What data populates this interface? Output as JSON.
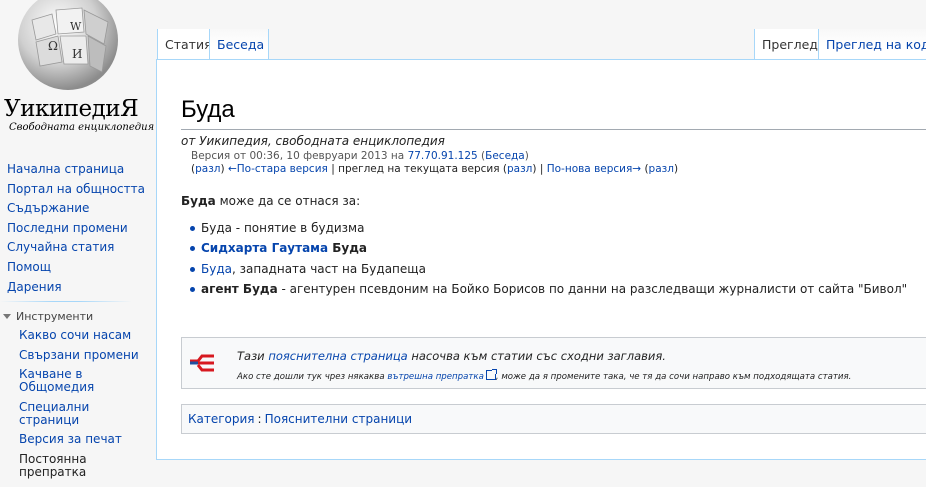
{
  "logo": {
    "wordmark": "УикипедиЯ",
    "tagline": "Свободната енциклопедия",
    "globe_glyphs": [
      "Ω",
      "W",
      "И"
    ]
  },
  "navigation": {
    "items": [
      {
        "label": "Начална страница"
      },
      {
        "label": "Портал на общността"
      },
      {
        "label": "Съдържание"
      },
      {
        "label": "Последни промени"
      },
      {
        "label": "Случайна статия"
      },
      {
        "label": "Помощ"
      },
      {
        "label": "Дарения"
      }
    ]
  },
  "tools": {
    "heading": "Инструменти",
    "items": [
      {
        "label": "Какво сочи насам"
      },
      {
        "label": "Свързани промени"
      },
      {
        "label": "Качване в Общомедия"
      },
      {
        "label": "Специални страници"
      },
      {
        "label": "Версия за печат"
      },
      {
        "label": "Постоянна препратка"
      }
    ]
  },
  "tabs": {
    "article": "Статия",
    "talk": "Беседа",
    "read": "Преглед",
    "view_source": "Преглед на кода"
  },
  "article": {
    "title": "Буда",
    "site_sub": "от Уикипедия, свободната енциклопедия",
    "revision": {
      "prefix": "Версия от 00:36, 10 февруари 2013 на ",
      "ip": "77.70.91.125",
      "talk_open": " (",
      "talk": "Беседа",
      "talk_close": ")",
      "diff1": "разл",
      "older": "←По-стара версия",
      "current": "преглед на текущата версия",
      "diff2": "разл",
      "newer": "По-нова версия→",
      "diff3": "разл"
    },
    "intro_bold": "Буда",
    "intro_rest": " може да се отнася за:",
    "items": [
      {
        "text": "Буда - понятие в будизма"
      },
      {
        "link": "Сидхарта Гаутама",
        "bold": " Буда"
      },
      {
        "link": "Буда",
        "rest": ", западната част на Будапеща"
      },
      {
        "bold": "агент Буда",
        "rest": " - агентурен псевдоним на Бойко Борисов по данни на разследващи журналисти от сайта \"Бивол\""
      }
    ]
  },
  "disambig": {
    "line1_a": "Тази ",
    "line1_link": "пояснителна страница",
    "line1_b": " насочва към статии със сходни заглавия.",
    "line2_a": "Ако сте дошли тук чрез някаква ",
    "line2_link": "вътрешна препратка",
    "line2_b": ", може да я промените така, че тя да сочи направо към подходящата статия."
  },
  "categories": {
    "label": "Категория",
    "colon": ":",
    "item": "Пояснителни страници"
  },
  "colors": {
    "link": "#0645ad",
    "border": "#a7d7f9",
    "disambig_red": "#d71920",
    "disambig_blue": "#1f4fa0"
  }
}
